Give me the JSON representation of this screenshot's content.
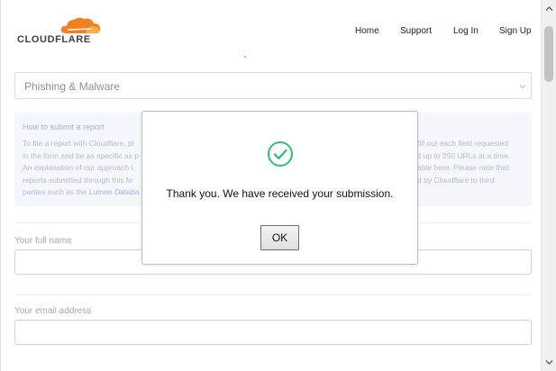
{
  "header": {
    "logo_text": "CLOUDFLARE",
    "nav": [
      "Home",
      "Support",
      "Log In",
      "Sign Up"
    ]
  },
  "form": {
    "report_type": "Phishing & Malware",
    "info": {
      "title": "How to submit a report",
      "body_1": "To file a report with Cloudflare, pl",
      "body_2": "in the form and be as specific as p",
      "body_3": "An explanation of our approach t",
      "body_4": "reports submitted through this fo",
      "body_5": "parties such as the ",
      "body_5_link": "Lumen Databa",
      "right_1": "fill out each field requested",
      "right_2": "it up to 250 URLs at a time.",
      "right_3": "able here. Please note that",
      "right_4": "d by Cloudflare to third"
    },
    "fields": [
      {
        "label": "Your full name",
        "value": ""
      },
      {
        "label": "Your email address",
        "value": ""
      }
    ]
  },
  "modal": {
    "message": "Thank you. We have received your submission.",
    "ok_label": "OK"
  },
  "colors": {
    "brand_orange": "#f38020",
    "success_green": "#2fbf71"
  }
}
